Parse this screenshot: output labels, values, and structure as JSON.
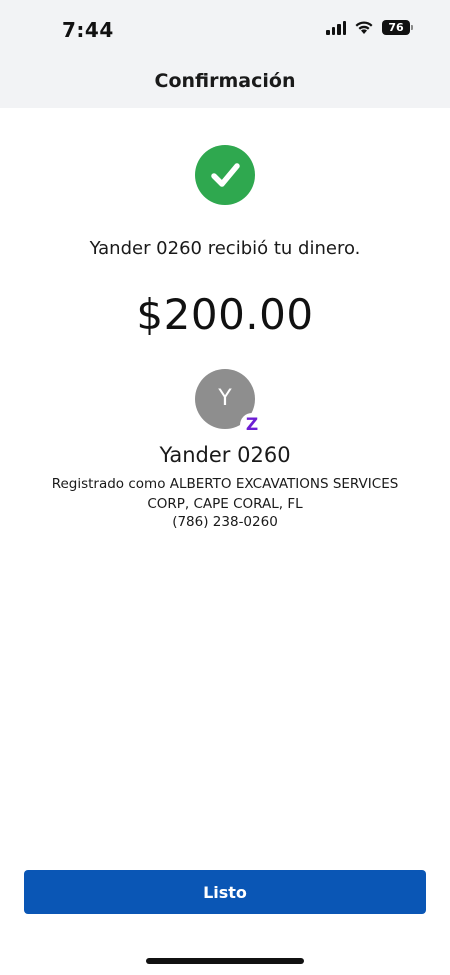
{
  "status_bar": {
    "time": "7:44",
    "battery_level": "76",
    "icons": [
      "signal-icon",
      "wifi-icon",
      "battery-icon"
    ]
  },
  "header": {
    "title": "Confirmación"
  },
  "confirmation": {
    "status_icon": "checkmark-circle-icon",
    "accent_color": "#2fa84f",
    "message": "Yander 0260 recibió tu dinero.",
    "amount": "$200.00"
  },
  "recipient": {
    "initial": "Y",
    "badge_icon": "zelle-icon",
    "badge_glyph": "Z",
    "name": "Yander 0260",
    "registered_as": "Registrado como ALBERTO EXCAVATIONS SERVICES CORP, CAPE CORAL, FL",
    "phone": "(786) 238-0260"
  },
  "actions": {
    "done_label": "Listo",
    "button_color": "#0a56b5"
  }
}
